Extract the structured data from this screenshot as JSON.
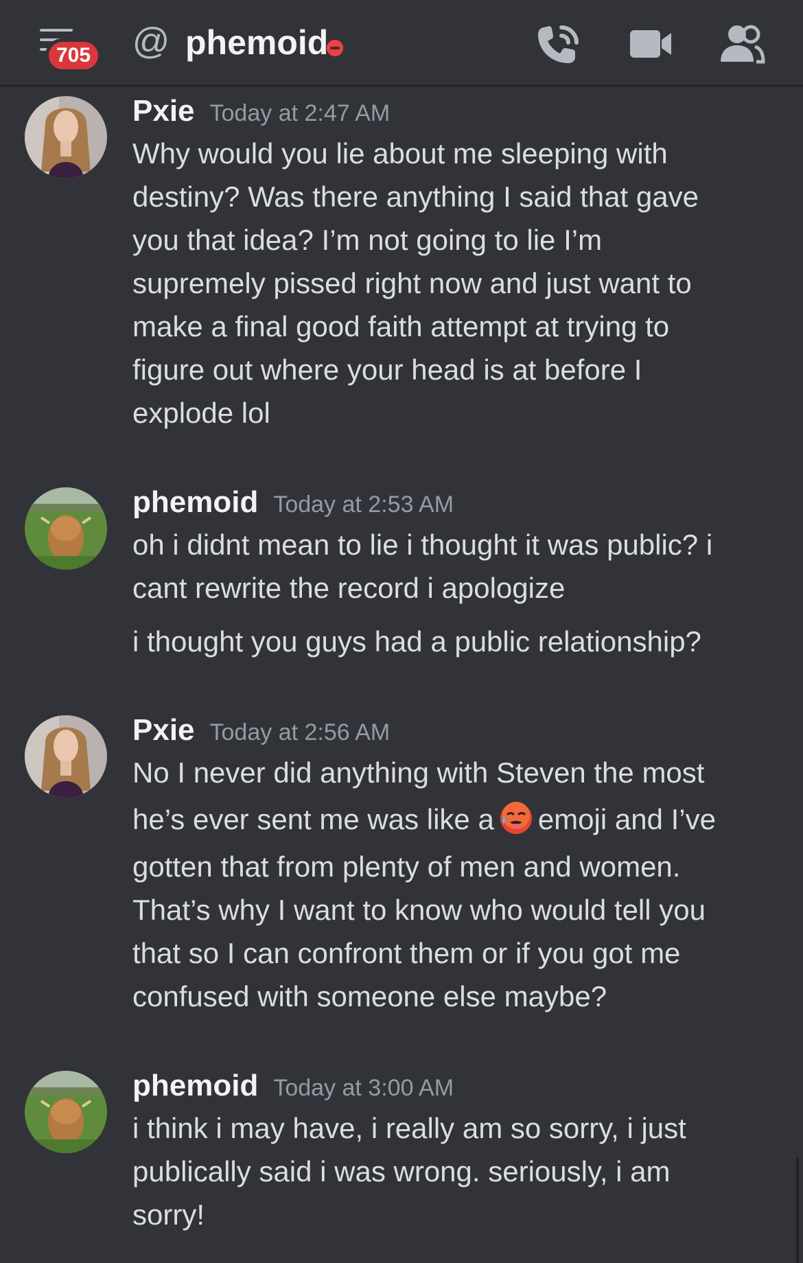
{
  "header": {
    "unread_badge": "705",
    "channel_name": "phemoid",
    "status": "do-not-disturb",
    "icons": [
      "hamburger-menu-icon",
      "at-icon",
      "voice-call-icon",
      "video-call-icon",
      "members-icon"
    ]
  },
  "colors": {
    "background": "#313338",
    "badge": "#da373c",
    "dnd": "#f23f43",
    "text": "#dbdee1",
    "muted": "#949ba4"
  },
  "messages": [
    {
      "author": "Pxie",
      "timestamp": "Today at 2:47 AM",
      "paragraphs": [
        {
          "lines": [
            "Why would you lie about me sleeping with",
            "destiny? Was there anything I said that gave",
            "you that idea? I’m not going to lie I’m",
            "supremely pissed right now and just want to",
            "make a final good faith attempt at trying to",
            "figure out where your head is at before I",
            "explode lol"
          ]
        }
      ]
    },
    {
      "author": "phemoid",
      "timestamp": "Today at 2:53 AM",
      "paragraphs": [
        {
          "lines": [
            "oh i didnt mean to lie i thought it was public? i",
            "cant rewrite the record i apologize"
          ]
        },
        {
          "lines": [
            "i thought you guys had a public relationship?"
          ]
        }
      ]
    },
    {
      "author": "Pxie",
      "timestamp": "Today at 2:56 AM",
      "paragraphs": [
        {
          "lines": [
            "No I never did anything with Steven the most",
            "he’s ever sent me was like a",
            "emoji and I’ve",
            "gotten that from plenty of men and women.",
            "That’s why I want to know who would tell you",
            "that so I can confront them or if you got me",
            "confused with someone else maybe?"
          ],
          "emoji": "hot-face-emoji"
        }
      ]
    },
    {
      "author": "phemoid",
      "timestamp": "Today at 3:00 AM",
      "paragraphs": [
        {
          "lines": [
            "i think i may have, i really am so sorry, i just",
            "publically said i was wrong. seriously, i am",
            "sorry!"
          ]
        }
      ]
    }
  ]
}
